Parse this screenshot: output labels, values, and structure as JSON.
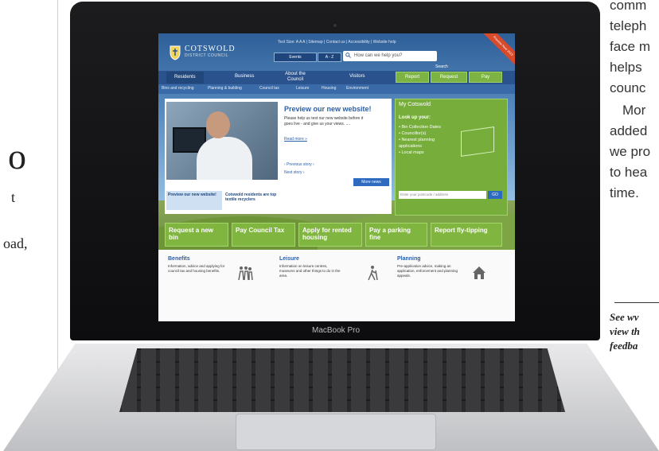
{
  "magazine": {
    "left_big": "o",
    "left_small": "t",
    "left_road": "oad,",
    "right_lines": [
      "comm",
      "teleph",
      "face m",
      "helps",
      "counc",
      "Mor",
      "added",
      "we pro",
      "to hea",
      "time."
    ],
    "right_italic": [
      "See wv",
      "view th",
      "feedba"
    ]
  },
  "laptop": {
    "brand": "MacBook Pro"
  },
  "site": {
    "logo_name": "COTSWOLD",
    "logo_sub": "DISTRICT COUNCIL",
    "toplinks": "Text Size: A A A  |  Sitemap  |  Contact us  |  Accessibility  |  Website help",
    "events": "Events",
    "az": "A - Z",
    "search_placeholder": "How can we help you?",
    "search_label": "Search",
    "ribbon": "Preview Now 2013",
    "nav": {
      "residents": "Residents",
      "business": "Business",
      "about": "About the Council",
      "visitors": "Visitors",
      "report": "Report",
      "request": "Request",
      "pay": "Pay"
    },
    "subnav": [
      "Bins and recycling",
      "Planning & building",
      "Council tax",
      "Leisure",
      "Housing",
      "Environment"
    ],
    "story": {
      "title": "Preview our new website!",
      "body": "Please help us test our new website before it goes live - and give us your views. ....",
      "read_more": "Read more »",
      "prev": "‹ Previous story ‹",
      "next": "Next story ›",
      "more_news": "More news",
      "thumb1": "Preview our new website!",
      "thumb2": "Cotswold residents are top textile recyclers"
    },
    "my_cotswold": {
      "title": "My Cotswold",
      "look": "Look up your:",
      "items": [
        "• Bin Collection Dates",
        "• Councillor(s)",
        "• Nearest planning applications",
        "• Local maps"
      ],
      "input_placeholder": "Enter your postcode / address",
      "go": "GO"
    },
    "tasks": [
      "Request a new bin",
      "Pay Council Tax",
      "Apply for rented housing",
      "Pay a parking fine",
      "Report fly-tipping"
    ],
    "info": [
      {
        "title": "Benefits",
        "body": "Information, advice and applying for council tax and housing benefits."
      },
      {
        "title": "Leisure",
        "body": "Information on leisure centres, museums and other things to do in the area."
      },
      {
        "title": "Planning",
        "body": "Pre-application advice, making an application, enforcement and planning appeals."
      }
    ]
  }
}
